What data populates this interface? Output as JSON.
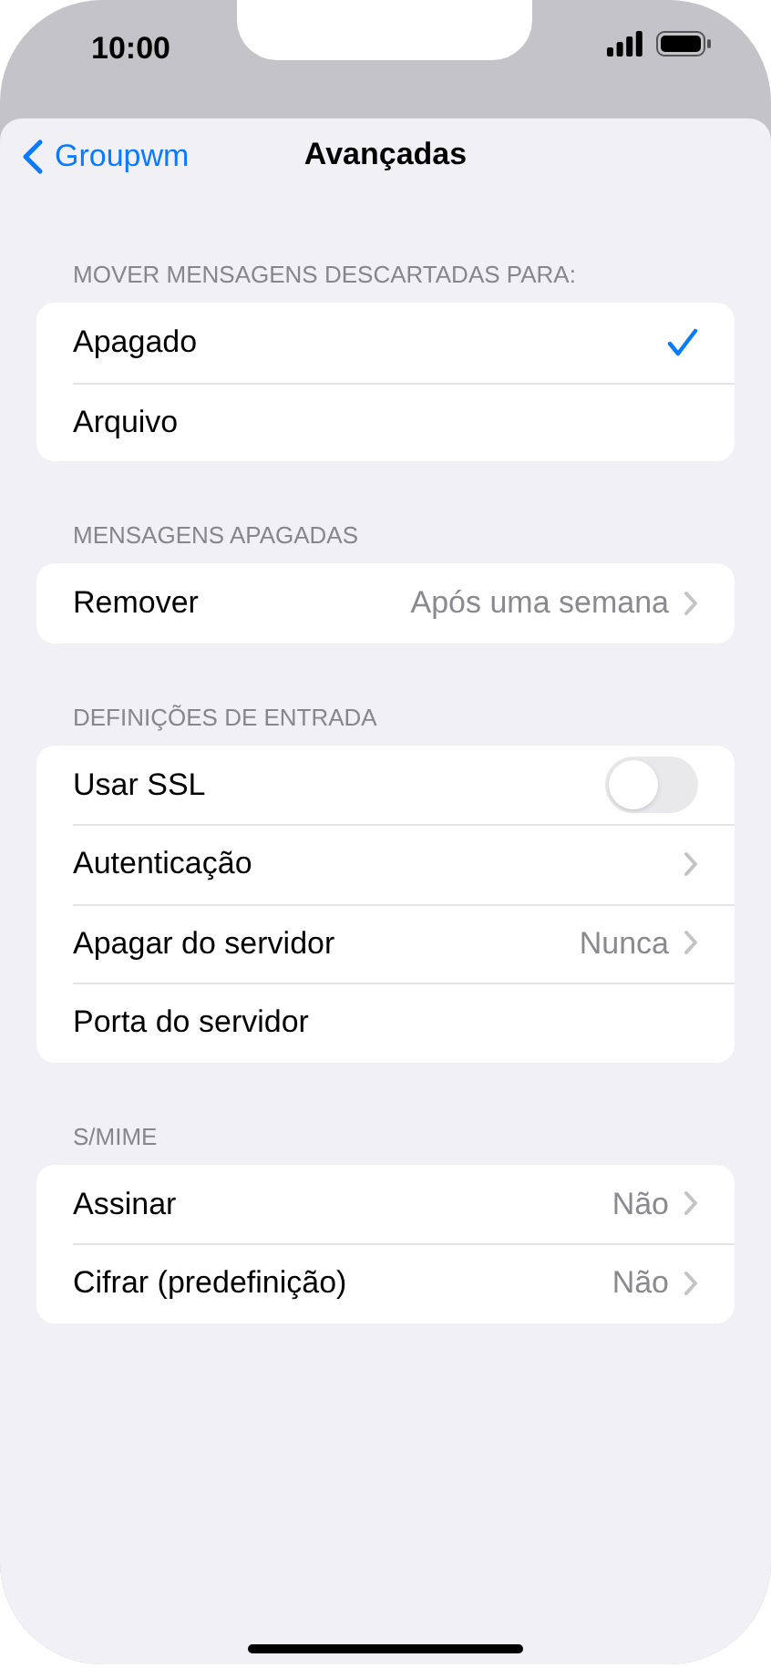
{
  "status_bar": {
    "time": "10:00"
  },
  "nav": {
    "back": "Groupwm",
    "title": "Avançadas"
  },
  "sections": [
    {
      "header": "MOVER MENSAGENS DESCARTADAS PARA:",
      "rows": [
        {
          "kind": "check",
          "label": "Apagado",
          "checked": true
        },
        {
          "kind": "check",
          "label": "Arquivo",
          "checked": false
        }
      ]
    },
    {
      "header": "MENSAGENS APAGADAS",
      "rows": [
        {
          "kind": "nav",
          "label": "Remover",
          "value": "Após uma semana"
        }
      ]
    },
    {
      "header": "DEFINIÇÕES DE ENTRADA",
      "rows": [
        {
          "kind": "toggle",
          "label": "Usar SSL",
          "on": false
        },
        {
          "kind": "nav",
          "label": "Autenticação"
        },
        {
          "kind": "nav",
          "label": "Apagar do servidor",
          "value": "Nunca"
        },
        {
          "kind": "plain",
          "label": "Porta do servidor"
        }
      ]
    },
    {
      "header": "S/MIME",
      "rows": [
        {
          "kind": "nav",
          "label": "Assinar",
          "value": "Não"
        },
        {
          "kind": "nav",
          "label": "Cifrar (predefinição)",
          "value": "Não"
        }
      ]
    }
  ]
}
